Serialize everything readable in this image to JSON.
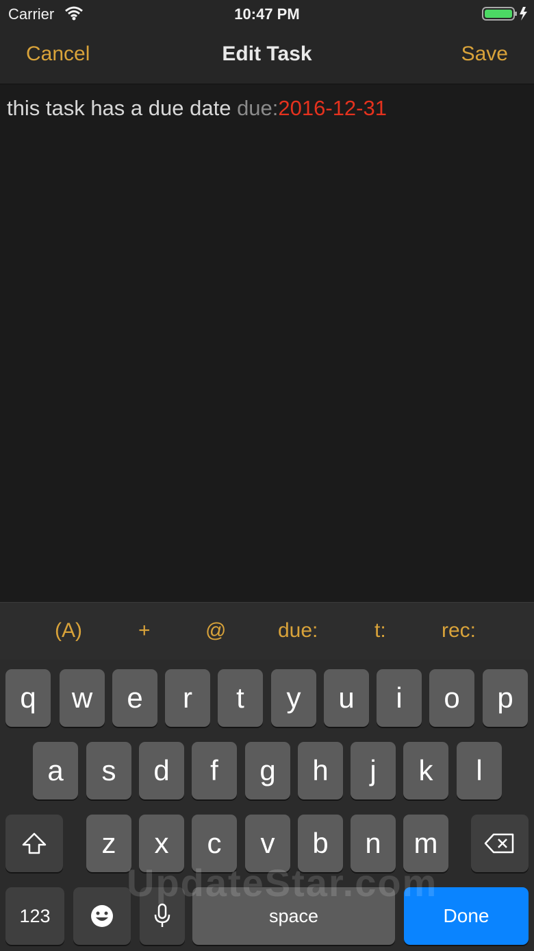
{
  "status_bar": {
    "carrier": "Carrier",
    "time": "10:47 PM",
    "battery_color": "#4cd964"
  },
  "nav": {
    "cancel": "Cancel",
    "title": "Edit Task",
    "save": "Save",
    "accent": "#d9a33a"
  },
  "editor": {
    "text_before": "this task has a due date ",
    "due_prefix": "due:",
    "due_value": "2016-12-31"
  },
  "toolbar": {
    "items": [
      "(A)",
      "+",
      "@",
      "due:",
      "t:",
      "rec:"
    ]
  },
  "keyboard": {
    "row1": [
      "q",
      "w",
      "e",
      "r",
      "t",
      "y",
      "u",
      "i",
      "o",
      "p"
    ],
    "row2": [
      "a",
      "s",
      "d",
      "f",
      "g",
      "h",
      "j",
      "k",
      "l"
    ],
    "row3": [
      "z",
      "x",
      "c",
      "v",
      "b",
      "n",
      "m"
    ],
    "shift_icon": "shift-icon",
    "delete_icon": "delete-icon",
    "numbers": "123",
    "emoji_icon": "emoji-icon",
    "mic_icon": "microphone-icon",
    "space": "space",
    "done": "Done"
  },
  "watermark": "UpdateStar.com"
}
